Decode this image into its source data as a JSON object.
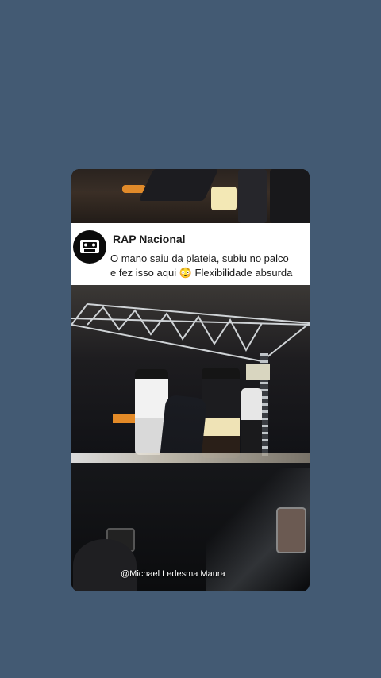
{
  "post": {
    "channel_name": "RAP Nacional",
    "caption_line1": "O mano saiu da plateia, subiu no palco",
    "caption_line2": "e fez isso aqui 😳 Flexibilidade absurda",
    "watermark": "@Michael Ledesma Maura",
    "logo_icon": "cassette-tape-icon"
  },
  "colors": {
    "background": "#435a73",
    "caption_bg": "#ffffff",
    "text": "#1a1a1a"
  }
}
